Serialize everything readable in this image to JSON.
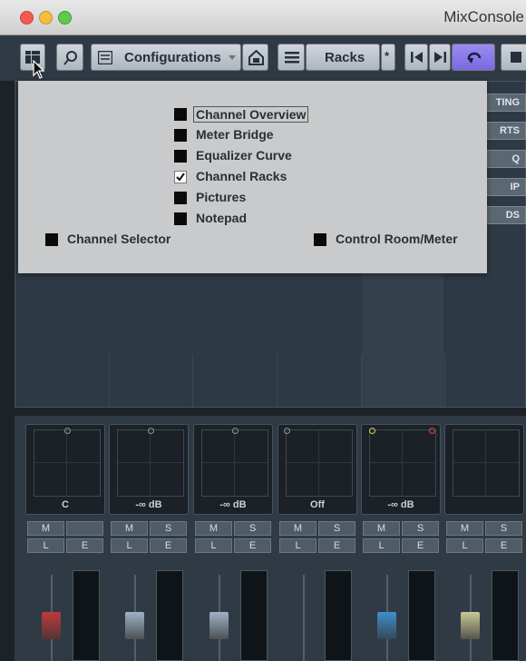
{
  "window": {
    "title": "MixConsole"
  },
  "toolbar": {
    "configurations_label": "Configurations",
    "racks_label": "Racks",
    "racks_star": "*"
  },
  "racks_visible": [
    "TING",
    "RTS",
    "Q",
    "IP",
    "DS"
  ],
  "popup": {
    "options": [
      {
        "label": "Channel Overview",
        "checked": false,
        "focused": true
      },
      {
        "label": "Meter Bridge",
        "checked": false
      },
      {
        "label": "Equalizer Curve",
        "checked": false
      },
      {
        "label": "Channel Racks",
        "checked": true
      },
      {
        "label": "Pictures",
        "checked": false
      },
      {
        "label": "Notepad",
        "checked": false
      }
    ],
    "channel_selector_label": "Channel Selector",
    "control_room_label": "Control Room/Meter"
  },
  "channels": [
    {
      "pan": "C",
      "fader_color": "#c0393b"
    },
    {
      "pan": "-∞ dB",
      "fader_color": "#9fb2c6"
    },
    {
      "pan": "-∞ dB",
      "fader_color": "#9fb2c6"
    },
    {
      "pan": "Off",
      "fader_color": "none"
    },
    {
      "pan": "-∞ dB",
      "fader_color": "#3f8fcb"
    },
    {
      "pan": "",
      "fader_color": "#c8c896"
    }
  ],
  "button_labels": {
    "m": "M",
    "s": "S",
    "l": "L",
    "e": "E"
  }
}
